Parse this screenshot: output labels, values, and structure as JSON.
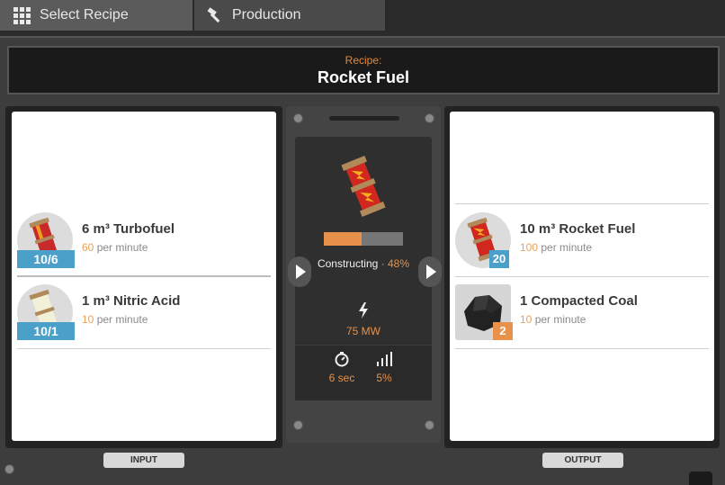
{
  "tabs": {
    "select_recipe": "Select Recipe",
    "production": "Production"
  },
  "recipe": {
    "label": "Recipe:",
    "name": "Rocket Fuel"
  },
  "inputs": [
    {
      "name": "6 m³ Turbofuel",
      "rate_num": "60",
      "rate_unit": "per minute",
      "count": "10/6",
      "icon": "turbofuel-canister-icon"
    },
    {
      "name": "1 m³ Nitric Acid",
      "rate_num": "10",
      "rate_unit": "per minute",
      "count": "10/1",
      "icon": "nitric-acid-canister-icon"
    }
  ],
  "outputs": [
    {
      "name": "10 m³ Rocket Fuel",
      "rate_num": "100",
      "rate_unit": "per minute",
      "count": "20",
      "icon": "rocket-fuel-canister-icon"
    },
    {
      "name": "1 Compacted Coal",
      "rate_num": "10",
      "rate_unit": "per minute",
      "count": "2",
      "icon": "compacted-coal-icon"
    }
  ],
  "machine": {
    "status_label": "Constructing",
    "status_sep": " · ",
    "progress_text": "48%",
    "progress": 0.48,
    "power": "75 MW",
    "cycle_time": "6 sec",
    "productivity": "5%"
  },
  "labels": {
    "input": "INPUT",
    "output": "OUTPUT"
  },
  "colors": {
    "accent": "#e8914b",
    "badge_blue": "#4aa0c9",
    "badge_orange": "#e8914b"
  }
}
